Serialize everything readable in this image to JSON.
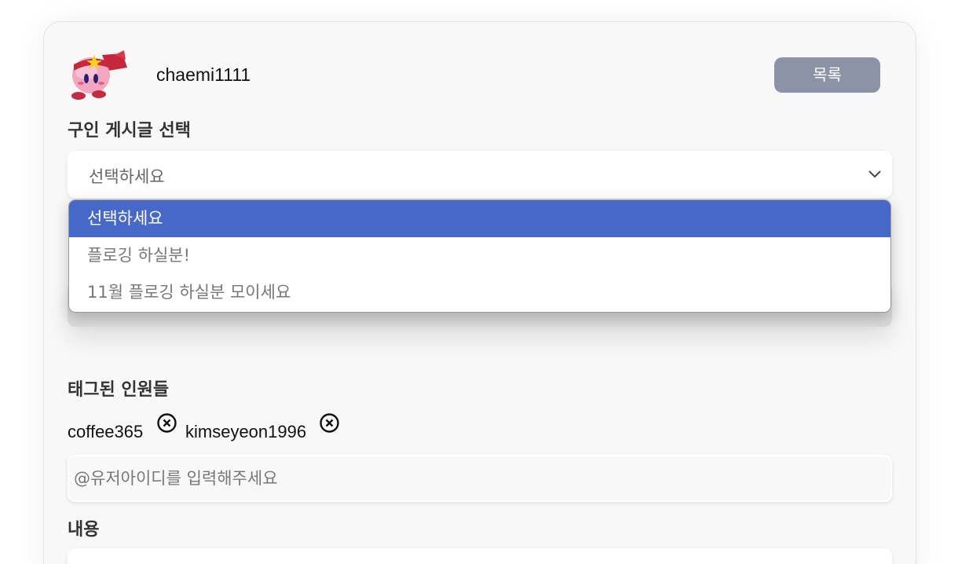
{
  "user": {
    "username": "chaemi1111"
  },
  "header": {
    "list_button": "목록"
  },
  "post_select": {
    "label": "구인 게시글 선택",
    "selected": "선택하세요",
    "options": [
      "선택하세요",
      "플로깅 하실분!",
      "11월 플로깅 하실분 모이세요"
    ]
  },
  "tagged": {
    "label": "태그된 인원들",
    "users": [
      "coffee365",
      "kimseyeon1996"
    ],
    "input_placeholder": "@유저아이디를 입력해주세요"
  },
  "content": {
    "label": "내용"
  },
  "colors": {
    "accent": "#4668c8",
    "button": "#8d93a6"
  }
}
